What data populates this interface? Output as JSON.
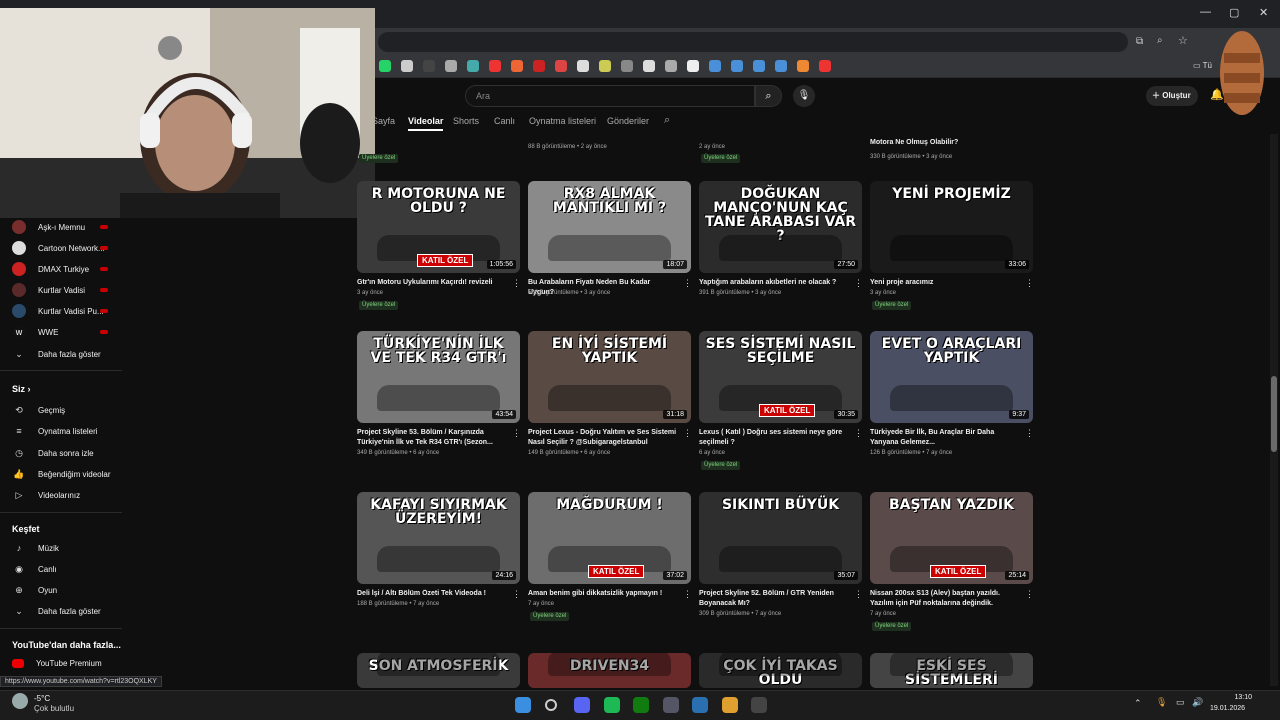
{
  "browser": {
    "window_controls": [
      "—",
      "▢",
      "✕"
    ],
    "status_url": "https://www.youtube.com/watch?v=rtl23OQXLKY",
    "bookmark_folder": "Tü"
  },
  "header": {
    "search_placeholder": "Ara",
    "create_label": "Oluştur"
  },
  "channel_tabs": [
    {
      "label": "Sayfa",
      "active": false
    },
    {
      "label": "Videolar",
      "active": true
    },
    {
      "label": "Shorts",
      "active": false
    },
    {
      "label": "Canlı",
      "active": false
    },
    {
      "label": "Oynatma listeleri",
      "active": false
    },
    {
      "label": "Gönderiler",
      "active": false
    }
  ],
  "sidebar": {
    "subscriptions": [
      {
        "label": "Aşk-ı Memnu",
        "icon": "channel-avatar"
      },
      {
        "label": "Cartoon Network...",
        "icon": "channel-avatar"
      },
      {
        "label": "DMAX Turkiye",
        "icon": "channel-avatar"
      },
      {
        "label": "Kurtlar Vadisi",
        "icon": "channel-avatar"
      },
      {
        "label": "Kurtlar Vadisi Pu...",
        "icon": "channel-avatar"
      },
      {
        "label": "WWE",
        "icon": "channel-avatar"
      }
    ],
    "more_subs": "Daha fazla göster",
    "you_heading": "Siz",
    "you_items": [
      {
        "label": "Geçmiş",
        "icon": "history-icon"
      },
      {
        "label": "Oynatma listeleri",
        "icon": "playlist-icon"
      },
      {
        "label": "Daha sonra izle",
        "icon": "clock-icon"
      },
      {
        "label": "Beğendiğim videolar",
        "icon": "thumbs-up-icon"
      },
      {
        "label": "Videolarınız",
        "icon": "video-icon"
      }
    ],
    "explore_heading": "Keşfet",
    "explore_items": [
      {
        "label": "Müzik",
        "icon": "music-icon"
      },
      {
        "label": "Canlı",
        "icon": "live-icon"
      },
      {
        "label": "Oyun",
        "icon": "gamepad-icon"
      }
    ],
    "more_explore": "Daha fazla göster",
    "more_heading": "YouTube'dan daha fazla...",
    "more_items": [
      {
        "label": "YouTube Premium",
        "icon": "youtube-premium-icon"
      }
    ]
  },
  "top_partial_row": [
    {
      "title": "",
      "meta": "",
      "badge": "Üyelere özel"
    },
    {
      "title": "",
      "meta": "88 B görüntüleme • 2 ay önce",
      "badge": ""
    },
    {
      "title": "",
      "meta": "2 ay önce",
      "badge": "Üyelere özel"
    },
    {
      "title": "Motora Ne Olmuş Olabilir?",
      "meta": "330 B görüntüleme • 3 ay önce",
      "badge": ""
    }
  ],
  "videos": [
    {
      "caption": "R MOTORUNA NE OLDU ?",
      "color": "#3a3a3a",
      "duration": "1:05:56",
      "title": "Gtr'ın Motoru Uykularımı Kaçırdı! revizeli",
      "meta": "3 ay önce",
      "badge": "Üyelere özel"
    },
    {
      "caption": "RX8 ALMAK MANTIKLI MI ?",
      "color": "#8a8a8a",
      "duration": "18:07",
      "title": "Bu Arabaların Fiyatı Neden Bu Kadar Uygun?",
      "meta": "508 B görüntüleme • 3 ay önce",
      "badge": ""
    },
    {
      "caption": "DOĞUKAN MANÇO'NUN KAÇ TANE ARABASI VAR ?",
      "color": "#2b2b2b",
      "duration": "27:50",
      "title": "Yaptığım arabaların akıbetleri ne olacak ?",
      "meta": "391 B görüntüleme • 3 ay önce",
      "badge": ""
    },
    {
      "caption": "YENİ PROJEMİZ",
      "color": "#1a1a1a",
      "duration": "33:06",
      "title": "Yeni proje aracımız",
      "meta": "3 ay önce",
      "badge": "Üyelere özel"
    },
    {
      "caption": "TÜRKİYE'NİN İLK VE TEK R34 GTR'ı",
      "color": "#777",
      "duration": "43:54",
      "title": "Project Skyline 53. Bölüm / Karşınızda Türkiye'nin İlk ve Tek R34 GTR'ı (Sezon...",
      "meta": "349 B görüntüleme • 6 ay önce",
      "badge": ""
    },
    {
      "caption": "EN İYİ SİSTEMİ YAPTIK",
      "color": "#5a4a44",
      "duration": "31:18",
      "title": "Project Lexus - Doğru Yalıtım ve Ses Sistemi Nasıl Seçilir ? @Subigaragelstanbul",
      "meta": "149 B görüntüleme • 6 ay önce",
      "badge": ""
    },
    {
      "caption": "SES SİSTEMİ NASIL SEÇİLME",
      "color": "#3b3b3b",
      "duration": "30:35",
      "title": "Lexus ( Katıl ) Doğru ses sistemi neye göre seçilmeli ?",
      "meta": "6 ay önce",
      "badge": "Üyelere özel"
    },
    {
      "caption": "EVET O ARAÇLARI YAPTIK",
      "color": "#4b4f63",
      "duration": "9:37",
      "title": "Türkiyede Bir İlk, Bu Araçlar Bir Daha Yanyana Gelemez...",
      "meta": "126 B görüntüleme • 7 ay önce",
      "badge": ""
    },
    {
      "caption": "KAFAYI SIYIRMAK ÜZEREYİM!",
      "color": "#555",
      "duration": "24:16",
      "title": "Deli İşi / Altı Bölüm Özeti Tek Videoda !",
      "meta": "188 B görüntüleme • 7 ay önce",
      "badge": ""
    },
    {
      "caption": "MAĞDURUM !",
      "color": "#6d6d6d",
      "duration": "37:02",
      "title": "Aman benim gibi dikkatsizlik yapmayın !",
      "meta": "7 ay önce",
      "badge": "Üyelere özel"
    },
    {
      "caption": "SIKINTI BÜYÜK",
      "color": "#2e2e2e",
      "duration": "35:07",
      "title": "Project Skyline 52. Bölüm / GTR Yeniden Boyanacak Mı?",
      "meta": "309 B görüntüleme • 7 ay önce",
      "badge": ""
    },
    {
      "caption": "BAŞTAN YAZDIK",
      "color": "#5b4a4a",
      "duration": "25:14",
      "title": "Nissan 200sx S13 (Alev) baştan yazıldı. Yazılım için Püf noktalarına değindik.",
      "meta": "7 ay önce",
      "badge": "Üyelere özel"
    },
    {
      "caption": "SON ATMOSFERİK",
      "color": "#3a3a3a",
      "duration": "",
      "title": "",
      "meta": "",
      "badge": ""
    },
    {
      "caption": "DRIVEN34",
      "color": "#6a2a2a",
      "duration": "",
      "title": "",
      "meta": "",
      "badge": ""
    },
    {
      "caption": "ÇOK İYİ TAKAS OLDU",
      "color": "#2a2a2a",
      "duration": "",
      "title": "",
      "meta": "",
      "badge": ""
    },
    {
      "caption": "ESKİ SES SİSTEMLERİ",
      "color": "#444",
      "duration": "",
      "title": "",
      "meta": "",
      "badge": ""
    }
  ],
  "overlay_badges": {
    "katil_ozel": "KATIL ÖZEL"
  },
  "taskbar": {
    "weather_temp": "-5°C",
    "weather_desc": "Çok bulutlu",
    "time": "13:10",
    "date": "19.01.2026"
  }
}
